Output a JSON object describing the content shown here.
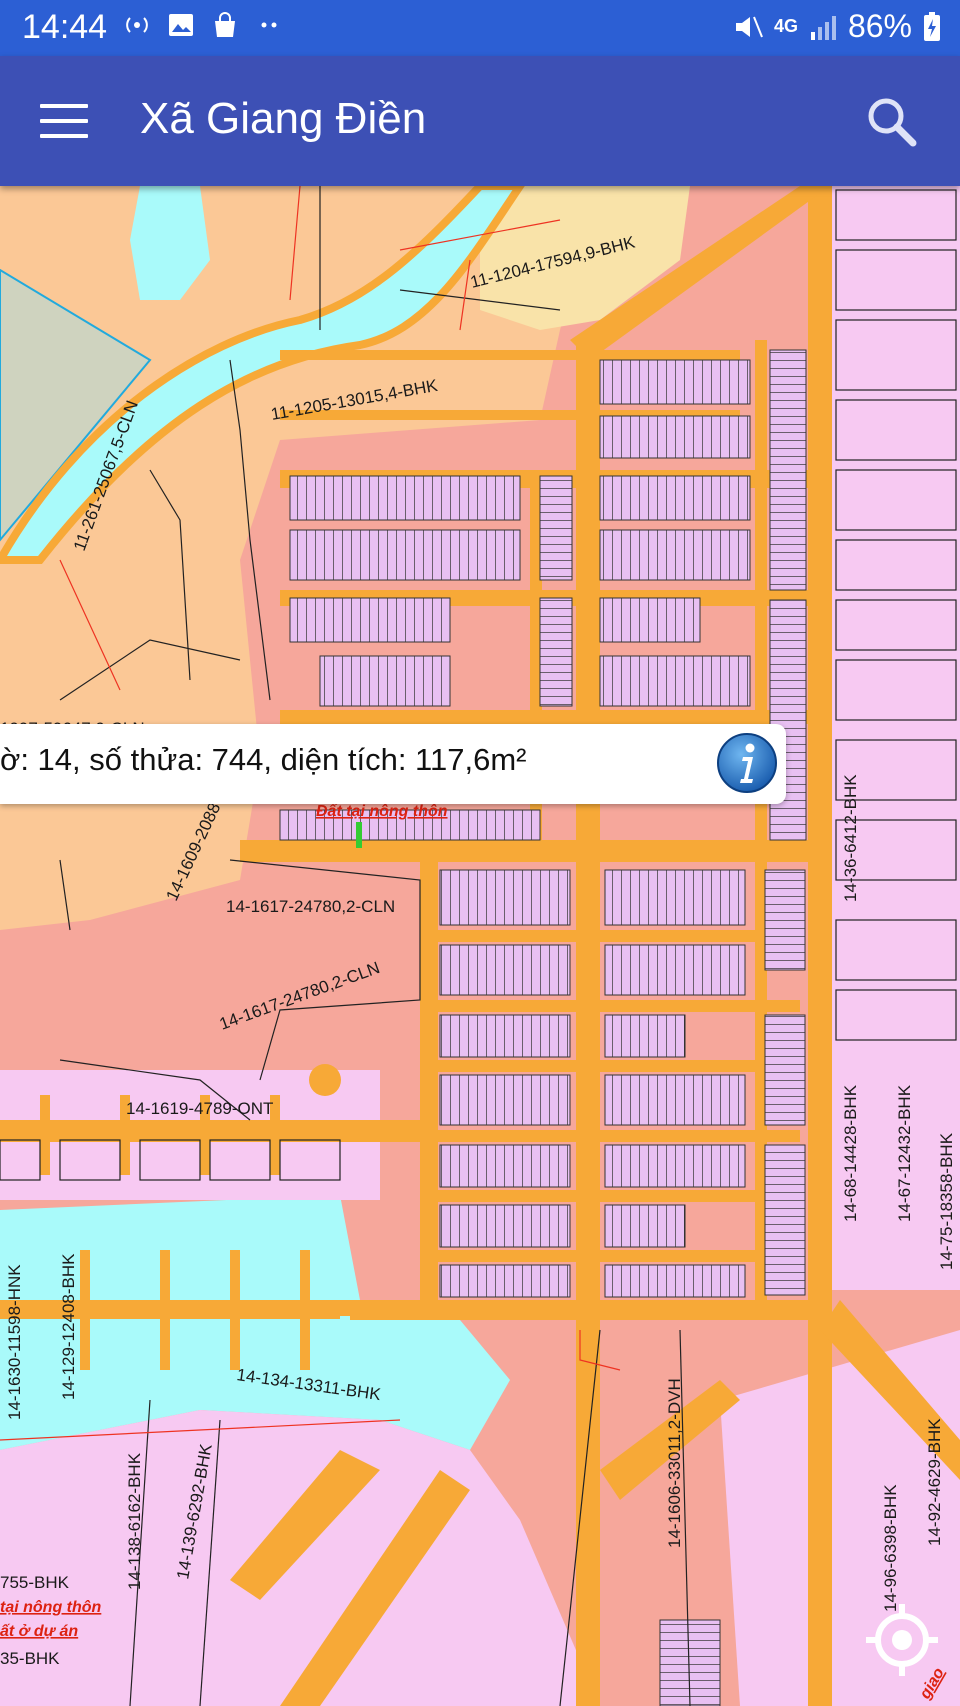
{
  "status_bar": {
    "time": "14:44",
    "network": "4G",
    "battery": "86%",
    "left_icons": [
      "wifi-hotspot-icon",
      "image-icon",
      "shopping-bag-icon",
      "more-dots-icon"
    ],
    "right_icons": [
      "mute-icon",
      "signal-icon",
      "battery-charging-icon"
    ]
  },
  "app_bar": {
    "title": "Xã Giang Điền",
    "menu_icon": "hamburger-menu-icon",
    "search_icon": "search-icon"
  },
  "info_bar": {
    "text": "ờ: 14, số thửa: 744, diện tích: 117,6m²",
    "icon": "info-icon"
  },
  "map": {
    "colors": {
      "road": "#f7a937",
      "residential": "#f7c9f2",
      "rural_land": "#f6a79b",
      "perennial_crop": "#fbc896",
      "annual_crop": "#f9e3a9",
      "water": "#a9fafa",
      "subdivided": "#d9b3e6"
    },
    "parcel_labels": [
      "11-1204-17594,9-BHK",
      "11-1205-13015,4-BHK",
      "11-261-25067,5-CLN",
      "14-1617-24780,2-CLN",
      "14-1617-24780,2-CLN",
      "14-1619-4789-ONT",
      "14-1609-2088",
      "14-36-6412-BHK",
      "14-68-14428-BHK",
      "14-67-12432-BHK",
      "14-75-18358-BHK",
      "14-92-4629-BHK",
      "14-96-6398-BHK",
      "14-1606-33011,2-DVH",
      "14-134-13311-BHK",
      "14-1630-11598-HNK",
      "14-129-12408-BHK",
      "14-138-6162-BHK",
      "14-139-6292-BHK",
      "755-BHK",
      "35-BHK",
      "1997-59647,9-CLN"
    ],
    "zone_labels": [
      "Đất    tại nông thôn",
      "tại nông thôn",
      "ất ở dự án",
      "giao"
    ]
  },
  "locate_icon": "my-location-icon"
}
